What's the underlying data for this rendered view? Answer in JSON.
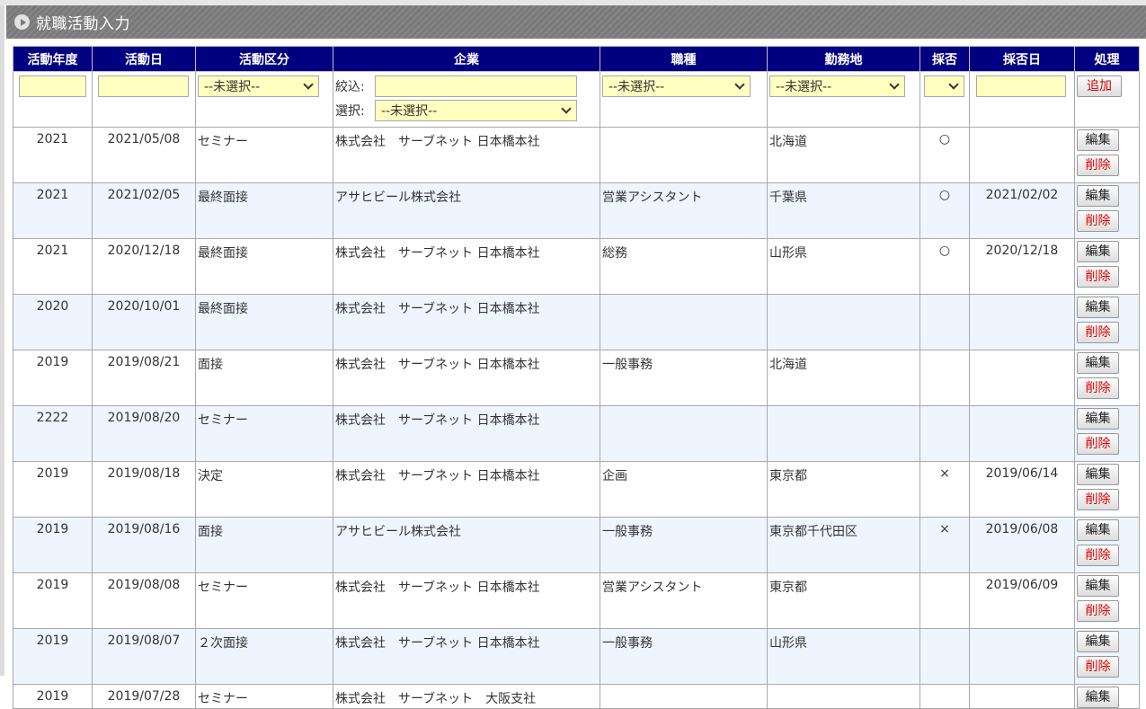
{
  "window": {
    "title": "就職活動入力"
  },
  "columns": [
    "活動年度",
    "活動日",
    "活動区分",
    "企業",
    "職種",
    "勤務地",
    "採否",
    "採否日",
    "処理"
  ],
  "filters": {
    "year_value": "",
    "date_value": "",
    "category_select": "--未選択--",
    "company_narrow_label": "絞込:",
    "company_narrow_value": "",
    "company_select_label": "選択:",
    "company_select": "--未選択--",
    "job_select": "--未選択--",
    "location_select": "--未選択--",
    "result_select": "",
    "result_date_value": "",
    "add_label": "追加"
  },
  "actions": {
    "edit_label": "編集",
    "delete_label": "削除"
  },
  "rows": [
    {
      "year": "2021",
      "date": "2021/05/08",
      "category": "セミナー",
      "company": "株式会社　サーブネット 日本橋本社",
      "job": "",
      "location": "北海道",
      "result": "○",
      "result_date": ""
    },
    {
      "year": "2021",
      "date": "2021/02/05",
      "category": "最終面接",
      "company": "アサヒビール株式会社",
      "job": "営業アシスタント",
      "location": "千葉県",
      "result": "○",
      "result_date": "2021/02/02"
    },
    {
      "year": "2021",
      "date": "2020/12/18",
      "category": "最終面接",
      "company": "株式会社　サーブネット 日本橋本社",
      "job": "総務",
      "location": "山形県",
      "result": "○",
      "result_date": "2020/12/18"
    },
    {
      "year": "2020",
      "date": "2020/10/01",
      "category": "最終面接",
      "company": "株式会社　サーブネット 日本橋本社",
      "job": "",
      "location": "",
      "result": "",
      "result_date": ""
    },
    {
      "year": "2019",
      "date": "2019/08/21",
      "category": "面接",
      "company": "株式会社　サーブネット 日本橋本社",
      "job": "一般事務",
      "location": "北海道",
      "result": "",
      "result_date": ""
    },
    {
      "year": "2222",
      "date": "2019/08/20",
      "category": "セミナー",
      "company": "株式会社　サーブネット 日本橋本社",
      "job": "",
      "location": "",
      "result": "",
      "result_date": ""
    },
    {
      "year": "2019",
      "date": "2019/08/18",
      "category": "決定",
      "company": "株式会社　サーブネット 日本橋本社",
      "job": "企画",
      "location": "東京都",
      "result": "×",
      "result_date": "2019/06/14"
    },
    {
      "year": "2019",
      "date": "2019/08/16",
      "category": "面接",
      "company": "アサヒビール株式会社",
      "job": "一般事務",
      "location": "東京都千代田区",
      "result": "×",
      "result_date": "2019/06/08"
    },
    {
      "year": "2019",
      "date": "2019/08/08",
      "category": "セミナー",
      "company": "株式会社　サーブネット 日本橋本社",
      "job": "営業アシスタント",
      "location": "東京都",
      "result": "",
      "result_date": "2019/06/09"
    },
    {
      "year": "2019",
      "date": "2019/08/07",
      "category": "２次面接",
      "company": "株式会社　サーブネット 日本橋本社",
      "job": "一般事務",
      "location": "山形県",
      "result": "",
      "result_date": ""
    },
    {
      "year": "2019",
      "date": "2019/07/28",
      "category": "セミナー",
      "company": "株式会社　サーブネット　大阪支社",
      "job": "",
      "location": "",
      "result": "",
      "result_date": ""
    }
  ],
  "colors": {
    "header_bg": "#000080",
    "row_alt": "#eef5ff",
    "input_bg": "#ffffc0",
    "title_bg": "#7a7a7a",
    "delete_text": "#e00000"
  }
}
